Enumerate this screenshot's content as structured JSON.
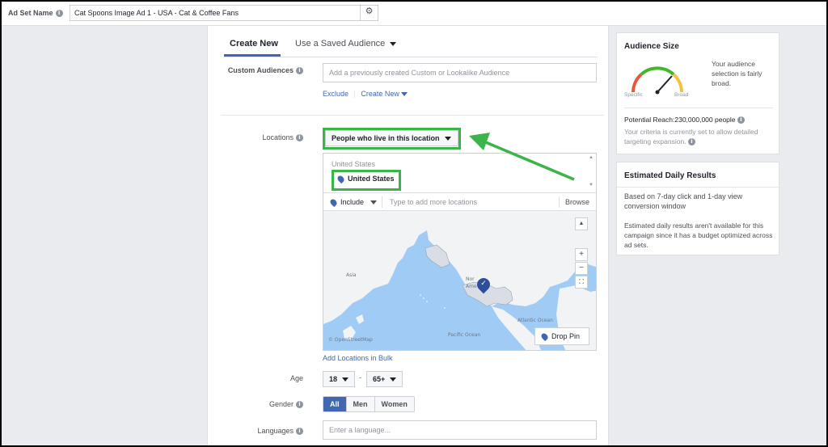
{
  "ad_set": {
    "label": "Ad Set Name",
    "name_value": "Cat Spoons Image Ad 1 - USA - Cat & Coffee Fans",
    "settings_icon": "gear-icon"
  },
  "audience_tabs": {
    "create_new": "Create New",
    "use_saved": "Use a Saved Audience"
  },
  "custom_audiences": {
    "label": "Custom Audiences",
    "placeholder": "Add a previously created Custom or Lookalike Audience",
    "exclude": "Exclude",
    "create_new": "Create New"
  },
  "locations": {
    "label": "Locations",
    "type_selector": "People who live in this location",
    "country_header": "United States",
    "selected": "United States",
    "include": "Include",
    "add_placeholder": "Type to add more locations",
    "browse": "Browse",
    "add_bulk": "Add Locations in Bulk"
  },
  "map": {
    "labels": {
      "asia": "Asia",
      "north_america": "Nor Ame",
      "atlantic": "Atlantic Ocean",
      "pacific": "Pacific Ocean",
      "credit": "© OpenStreetMap"
    },
    "zoom_in": "+",
    "zoom_out": "−",
    "drop_pin": "Drop Pin"
  },
  "age": {
    "label": "Age",
    "min": "18",
    "dash": "-",
    "max": "65+"
  },
  "gender": {
    "label": "Gender",
    "options": [
      "All",
      "Men",
      "Women"
    ],
    "selected": "All"
  },
  "languages": {
    "label": "Languages",
    "placeholder": "Enter a language..."
  },
  "audience_size": {
    "title": "Audience Size",
    "gauge_low": "Specific",
    "gauge_high": "Broad",
    "description": "Your audience selection is fairly broad.",
    "potential_reach": "Potential Reach:230,000,000 people",
    "criteria_note": "Your criteria is currently set to allow detailed targeting expansion.",
    "colors": {
      "low": "#e9573f",
      "mid": "#42b72a",
      "high": "#f5c33b"
    }
  },
  "daily_results": {
    "title": "Estimated Daily Results",
    "basis": "Based on 7-day click and 1-day view conversion window",
    "note": "Estimated daily results aren't available for this campaign since it has a budget optimized across ad sets."
  },
  "annotation": {
    "highlight_color": "#3bb54a"
  }
}
